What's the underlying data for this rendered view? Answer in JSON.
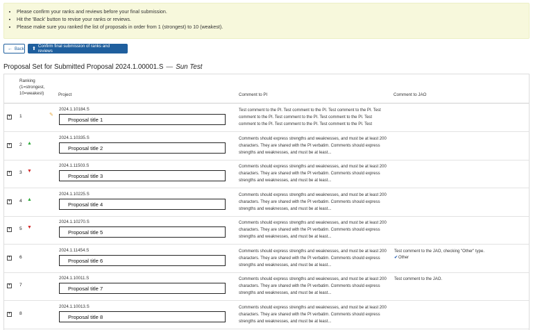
{
  "notice": {
    "items": [
      "Please confirm your ranks and reviews before your final submission.",
      "Hit the 'Back' button to revise your ranks or reviews.",
      "Please make sure you ranked the list of proposals in order from 1 (strongest) to 10 (weakest)."
    ]
  },
  "toolbar": {
    "back_label": "Back",
    "confirm_label": "Confirm final submission of ranks and reviews"
  },
  "page": {
    "heading_prefix": "Proposal Set for Submitted Proposal 2024.1.00001.S",
    "heading_sep": "—",
    "heading_name": "Sun Test"
  },
  "table": {
    "headers": {
      "ranking": "Ranking (1=strongest, 10=weakest)",
      "project": "Project",
      "comment_pi": "Comment to PI",
      "comment_jao": "Comment to JAO"
    },
    "rows": [
      {
        "rank": "1",
        "move": "edit",
        "id": "2024.1.10184.S",
        "title": "Proposal title 1",
        "pi": "Test comment to the PI. Test comment to the PI. Test comment to the PI. Test comment to the PI. Test comment to the PI. Test comment to the PI. Test comment to the PI. Test comment to the PI. Test comment to the PI. Test comment to the PI. Test comment to the PI...",
        "jao": "",
        "jao_type": ""
      },
      {
        "rank": "2",
        "move": "up",
        "id": "2024.1.10335.S",
        "title": "Proposal title 2",
        "pi": "Comments should express strengths and weaknesses, and must be at least 200 characters. They are shared with the PI verbatim. Comments should express strengths and weaknesses, and must be at least...",
        "jao": "",
        "jao_type": ""
      },
      {
        "rank": "3",
        "move": "down",
        "id": "2024.1.11503.S",
        "title": "Proposal title 3",
        "pi": "Comments should express strengths and weaknesses, and must be at least 200 characters. They are shared with the PI verbatim. Comments should express strengths and weaknesses, and must be at least...",
        "jao": "",
        "jao_type": ""
      },
      {
        "rank": "4",
        "move": "up",
        "id": "2024.1.10225.S",
        "title": "Proposal title 4",
        "pi": "Comments should express strengths and weaknesses, and must be at least 200 characters. They are shared with the PI verbatim. Comments should express strengths and weaknesses, and must be at least...",
        "jao": "",
        "jao_type": ""
      },
      {
        "rank": "5",
        "move": "down",
        "id": "2024.1.10270.S",
        "title": "Proposal title 5",
        "pi": "Comments should express strengths and weaknesses, and must be at least 200 characters. They are shared with the PI verbatim. Comments should express strengths and weaknesses, and must be at least...",
        "jao": "",
        "jao_type": ""
      },
      {
        "rank": "6",
        "move": "",
        "id": "2024.1.11454.S",
        "title": "Proposal title 6",
        "pi": "Comments should express strengths and weaknesses, and must be at least 200 characters. They are shared with the PI verbatim. Comments should express strengths and weaknesses, and must be at least...",
        "jao": "Test comment to the JAO, checking \"Other\" type.",
        "jao_type": "Other"
      },
      {
        "rank": "7",
        "move": "",
        "id": "2024.1.10011.S",
        "title": "Proposal title 7",
        "pi": "Comments should express strengths and weaknesses, and must be at least 200 characters. They are shared with the PI verbatim. Comments should express strengths and weaknesses, and must be at least...",
        "jao": "Test comment to the JAO.",
        "jao_type": ""
      },
      {
        "rank": "8",
        "move": "",
        "id": "2024.1.10013.S",
        "title": "Proposal title 8",
        "pi": "Comments should express strengths and weaknesses, and must be at least 200 characters. They are shared with the PI verbatim. Comments should express strengths and weaknesses, and must be at least...",
        "jao": "",
        "jao_type": ""
      }
    ]
  },
  "icons": {
    "expand": "plus-square-icon",
    "edit": "pencil-icon",
    "up": "arrow-up-icon",
    "down": "arrow-down-icon",
    "check": "checkmark-icon",
    "back": "arrow-left-icon",
    "confirm": "upload-icon"
  },
  "colors": {
    "accent": "#1f5f9e",
    "notice_bg": "#f7f8dc",
    "up": "#2eaa3a",
    "down": "#d32a2a",
    "edit": "#e4a53a"
  }
}
